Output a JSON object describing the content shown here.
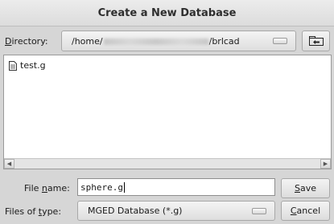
{
  "window": {
    "title": "Create a New Database"
  },
  "directory": {
    "label_pre": "",
    "label_ul": "D",
    "label_post": "irectory:",
    "path_start": "/home/",
    "path_end": "/brlcad"
  },
  "files": [
    {
      "name": "test.g",
      "icon": "file-icon"
    }
  ],
  "filename": {
    "label_pre": "File ",
    "label_ul": "n",
    "label_post": "ame:",
    "value": "sphere.g"
  },
  "filetype": {
    "label_pre": "Files of ",
    "label_ul": "t",
    "label_post": "ype:",
    "selected": "MGED Database (*.g)"
  },
  "buttons": {
    "save_ul": "S",
    "save_rest": "ave",
    "cancel_ul": "C",
    "cancel_rest": "ancel",
    "up_icon": "folder-up-icon"
  }
}
